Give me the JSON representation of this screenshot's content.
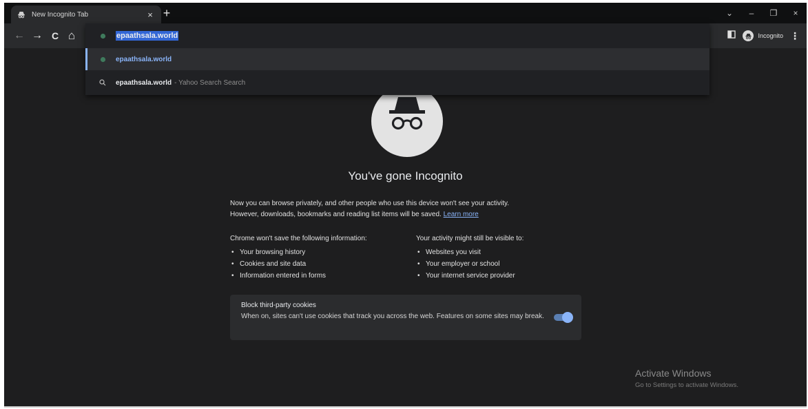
{
  "tab": {
    "title": "New Incognito Tab",
    "close": "×",
    "new_tab": "+"
  },
  "window_controls": {
    "chevron": "⌄",
    "minimize": "–",
    "restore": "❐",
    "close": "×"
  },
  "toolbar": {
    "back": "←",
    "forward": "→",
    "reload": "C",
    "home": "⌂",
    "profile_label": "Incognito",
    "menu": "⋮"
  },
  "omnibox": {
    "input_value": "epaathsala.world",
    "suggestions": [
      {
        "text": "epaathsala.world",
        "icon": "globe-icon",
        "selected": true
      },
      {
        "text": "epaathsala.world",
        "suffix": "- Yahoo Search Search",
        "icon": "search-icon",
        "selected": false
      }
    ]
  },
  "content": {
    "headline": "You've gone Incognito",
    "intro_line1": "Now you can browse privately, and other people who use this device won't see your activity.",
    "intro_line2": "However, downloads, bookmarks and reading list items will be saved.",
    "learn_more": "Learn more",
    "left_title": "Chrome won't save the following information:",
    "left_items": [
      "Your browsing history",
      "Cookies and site data",
      "Information entered in forms"
    ],
    "right_title": "Your activity might still be visible to:",
    "right_items": [
      "Websites you visit",
      "Your employer or school",
      "Your internet service provider"
    ]
  },
  "cookie_card": {
    "title": "Block third-party cookies",
    "description": "When on, sites can't use cookies that track you across the web. Features on some sites may break.",
    "toggle_on": true
  },
  "watermark": {
    "title": "Activate Windows",
    "subtitle": "Go to Settings to activate Windows."
  },
  "colors": {
    "background": "#1e1e1f",
    "accent": "#8ab4f8",
    "highlight": "#3367d6"
  }
}
